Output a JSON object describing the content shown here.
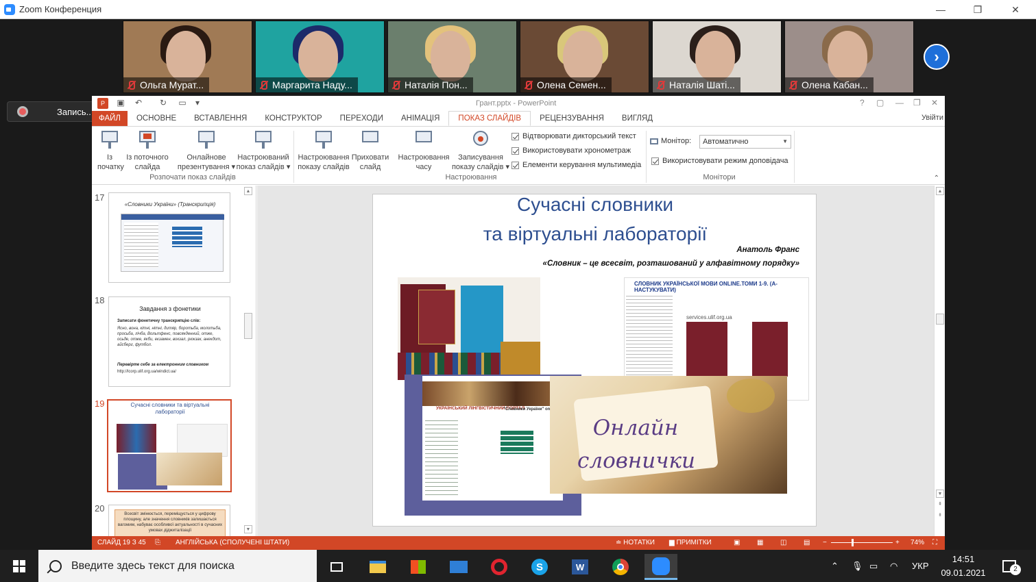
{
  "window": {
    "title": "Zoom Конференция"
  },
  "participants": [
    {
      "name": "Ольга Мурат...",
      "bg": "#a07a55",
      "hair": "#2a1a12"
    },
    {
      "name": "Маргарита Наду...",
      "bg": "#1fa3a0",
      "hair": "#1c2a6a"
    },
    {
      "name": "Наталія Пон...",
      "bg": "#6b7f6d",
      "hair": "#e3c27c"
    },
    {
      "name": "Олена Семен...",
      "bg": "#6a4a35",
      "hair": "#d9c77a"
    },
    {
      "name": "Наталія Шаті...",
      "bg": "#dcd7d0",
      "hair": "#2b1f1a"
    },
    {
      "name": "Олена Кабан...",
      "bg": "#9c8e8a",
      "hair": "#8a6a4a"
    }
  ],
  "recording": {
    "label": "Запись..."
  },
  "ppt": {
    "title": "Грант.pptx - PowerPoint",
    "help": "?",
    "tabs": [
      "ФАЙЛ",
      "ОСНОВНЕ",
      "ВСТАВЛЕННЯ",
      "КОНСТРУКТОР",
      "ПЕРЕХОДИ",
      "АНІМАЦІЯ",
      "ПОКАЗ СЛАЙДІВ",
      "РЕЦЕНЗУВАННЯ",
      "ВИГЛЯД"
    ],
    "login": "Увійти",
    "ribbon": {
      "btn_from_start": "Із\nпочатку",
      "btn_from_current": "Із поточного\nслайда",
      "btn_online": "Онлайнове\nпрезентування ▾",
      "btn_custom": "Настроюваний\nпоказ слайдів ▾",
      "group_start": "Розпочати показ слайдів",
      "btn_setup": "Настроювання\nпоказу слайдів",
      "btn_hide": "Приховати\nслайд",
      "btn_rehearse": "Настроювання\nчасу",
      "btn_record": "Записування\nпоказу слайдів ▾",
      "chk_narration": "Відтворювати дикторський текст",
      "chk_timings": "Використовувати хронометраж",
      "chk_media": "Елементи керування мультимедіа",
      "group_setup": "Настроювання",
      "monitor_label": "Монітор:",
      "monitor_value": "Автоматично",
      "chk_presenter": "Використовувати режим доповідача",
      "group_monitors": "Монітори"
    },
    "thumbs": [
      {
        "num": "17",
        "title": "«Словники України» (Транскрипція)"
      },
      {
        "num": "18",
        "title": "Завдання з фонетики",
        "line1": "Записати фонетичну транскрипцію слів:",
        "body": "Ясно, вона, кітні, нітні, дитяр, боротьба, молотьба, просьба, лічба, Вольтфенс, повсякденний, отже, осьде, отже, якби, екзамен, вокзал, рюкзак, анекдот, айсберг, футбол.",
        "check": "Перевірте себе за електронним словником",
        "url": "http://lcorp.ulif.org.ua/windict.ua/"
      },
      {
        "num": "19",
        "title": "Сучасні словники та віртуальні лабораторії"
      },
      {
        "num": "20",
        "body": "Всесвіт змінюється, переміщується у цифрову площину, але значення словників залишається вагомим, набуває особливої актуальності в сучасних умовах діджиталізації"
      }
    ],
    "slide": {
      "title1": "Сучасні словники",
      "title2": "та віртуальні лабораторії",
      "author": "Анатоль Франс",
      "quote": "«Словник – це всесвіт, розташований у алфавітному порядку»",
      "dict_header": "СЛОВНИК УКРАЇНСЬКОЇ МОВИ ONLINE.ТОМИ 1-9. (А-НАСТУКУВАТИ)",
      "dict_url": "services.ulif.org.ua",
      "portal_caption": "УКРАЇНСЬКИЙ ЛІНГВІСТИЧНИЙ ПОРТАЛ",
      "portal_caption2": "\"Словники України\" on-line",
      "online_text1": "Онлайн",
      "online_text2": "словнички"
    },
    "status": {
      "slide": "СЛАЙД 19 З 45",
      "lang": "АНГЛІЙСЬКА (СПОЛУЧЕНІ ШТАТИ)",
      "notes": "НОТАТКИ",
      "comments": "ПРИМІТКИ",
      "zoom": "74%"
    }
  },
  "taskbar": {
    "search_placeholder": "Введите здесь текст для поиска",
    "lang": "УКР",
    "time": "14:51",
    "date": "09.01.2021",
    "notif_count": "2"
  }
}
